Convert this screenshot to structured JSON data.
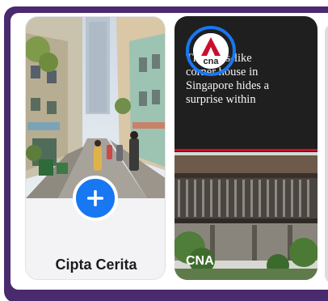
{
  "stories": {
    "create": {
      "label": "Cipta Cerita"
    },
    "news": {
      "headline_lines": [
        "The glass-like",
        "corner house in",
        "Singapore hides a",
        "surprise within"
      ],
      "source": "CNA",
      "logo_text": "cna"
    }
  },
  "colors": {
    "frame_purple": "#4a2a6e",
    "accent_blue": "#1877f2",
    "cna_red": "#c8102e"
  },
  "icons": {
    "add": "plus-icon"
  }
}
